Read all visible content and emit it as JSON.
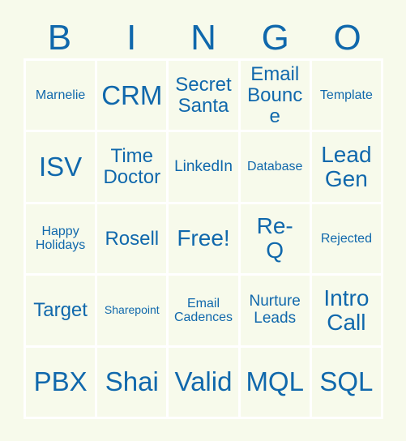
{
  "card": {
    "title": "BINGO",
    "colors": {
      "background": "#f7faeb",
      "text": "#1068ac",
      "gridline": "#ffffff",
      "cell_background": "#f7faeb"
    },
    "header": {
      "letters": [
        "B",
        "I",
        "N",
        "G",
        "O"
      ]
    },
    "grid": {
      "rows": 5,
      "columns": 5,
      "free_space": "Free!",
      "cells": [
        [
          {
            "label": "Marnelie",
            "size": "xs"
          },
          {
            "label": "CRM",
            "size": "xl"
          },
          {
            "label": "Secret\nSanta",
            "size": "md"
          },
          {
            "label": "Email\nBounce",
            "size": "md"
          },
          {
            "label": "Template",
            "size": "xs"
          }
        ],
        [
          {
            "label": "ISV",
            "size": "xl"
          },
          {
            "label": "Time\nDoctor",
            "size": "md"
          },
          {
            "label": "LinkedIn",
            "size": "sm"
          },
          {
            "label": "Database",
            "size": "xs"
          },
          {
            "label": "Lead\nGen",
            "size": "lg"
          }
        ],
        [
          {
            "label": "Happy\nHolidays",
            "size": "xs"
          },
          {
            "label": "Rosell",
            "size": "md"
          },
          {
            "label": "Free!",
            "size": "lg"
          },
          {
            "label": "Re-\nQ",
            "size": "lg"
          },
          {
            "label": "Rejected",
            "size": "xs"
          }
        ],
        [
          {
            "label": "Target",
            "size": "md"
          },
          {
            "label": "Sharepoint",
            "size": "xxs"
          },
          {
            "label": "Email\nCadences",
            "size": "xs"
          },
          {
            "label": "Nurture\nLeads",
            "size": "sm"
          },
          {
            "label": "Intro\nCall",
            "size": "lg"
          }
        ],
        [
          {
            "label": "PBX",
            "size": "xl"
          },
          {
            "label": "Shai",
            "size": "xl"
          },
          {
            "label": "Valid",
            "size": "xl"
          },
          {
            "label": "MQL",
            "size": "xl"
          },
          {
            "label": "SQL",
            "size": "xl"
          }
        ]
      ]
    }
  }
}
